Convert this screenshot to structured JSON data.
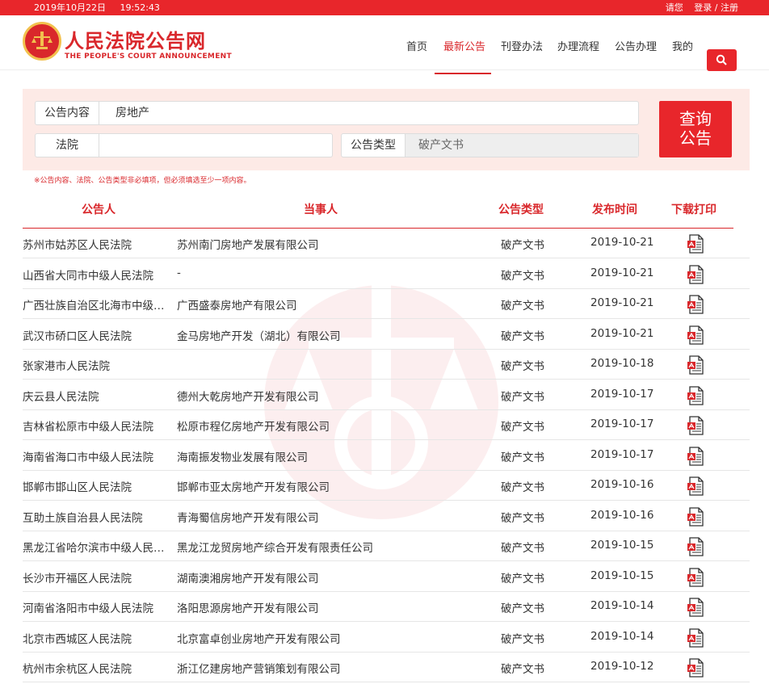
{
  "topbar": {
    "date": "2019年10月22日",
    "time": "19:52:43",
    "greeting": "请您",
    "login": "登录 / 注册"
  },
  "brand": {
    "name": "人民法院公告网",
    "english": "THE PEOPLE'S COURT ANNOUNCEMENT"
  },
  "nav": {
    "items": [
      "首页",
      "最新公告",
      "刊登办法",
      "办理流程",
      "公告办理",
      "我的"
    ],
    "active_index": 1
  },
  "search_form": {
    "content_label": "公告内容",
    "content_value": "房地产",
    "court_label": "法院",
    "court_value": "",
    "type_label": "公告类型",
    "type_value": "破产文书",
    "query_button": [
      "查询",
      "公告"
    ],
    "hint": "※公告内容、法院、公告类型非必填项，但必须填选至少一项内容。"
  },
  "table": {
    "headers": [
      "公告人",
      "当事人",
      "公告类型",
      "发布时间",
      "下载打印"
    ],
    "rows": [
      {
        "court": "苏州市姑苏区人民法院",
        "party": "苏州南门房地产发展有限公司",
        "type": "破产文书",
        "date": "2019-10-21"
      },
      {
        "court": "山西省大同市中级人民法院",
        "party": "-",
        "type": "破产文书",
        "date": "2019-10-21"
      },
      {
        "court": "广西壮族自治区北海市中级人...",
        "party": "广西盛泰房地产有限公司",
        "type": "破产文书",
        "date": "2019-10-21"
      },
      {
        "court": "武汉市硚口区人民法院",
        "party": "金马房地产开发（湖北）有限公司",
        "type": "破产文书",
        "date": "2019-10-21"
      },
      {
        "court": "张家港市人民法院",
        "party": "",
        "type": "破产文书",
        "date": "2019-10-18"
      },
      {
        "court": "庆云县人民法院",
        "party": "德州大乾房地产开发有限公司",
        "type": "破产文书",
        "date": "2019-10-17"
      },
      {
        "court": "吉林省松原市中级人民法院",
        "party": "松原市程亿房地产开发有限公司",
        "type": "破产文书",
        "date": "2019-10-17"
      },
      {
        "court": "海南省海口市中级人民法院",
        "party": "海南振发物业发展有限公司",
        "type": "破产文书",
        "date": "2019-10-17"
      },
      {
        "court": "邯郸市邯山区人民法院",
        "party": "邯郸市亚太房地产开发有限公司",
        "type": "破产文书",
        "date": "2019-10-16"
      },
      {
        "court": "互助土族自治县人民法院",
        "party": "青海蜀信房地产开发有限公司",
        "type": "破产文书",
        "date": "2019-10-16"
      },
      {
        "court": "黑龙江省哈尔滨市中级人民法院",
        "party": "黑龙江龙贸房地产综合开发有限责任公司",
        "type": "破产文书",
        "date": "2019-10-15"
      },
      {
        "court": "长沙市开福区人民法院",
        "party": "湖南澳湘房地产开发有限公司",
        "type": "破产文书",
        "date": "2019-10-15"
      },
      {
        "court": "河南省洛阳市中级人民法院",
        "party": "洛阳思源房地产开发有限公司",
        "type": "破产文书",
        "date": "2019-10-14"
      },
      {
        "court": "北京市西城区人民法院",
        "party": "北京富卓创业房地产开发有限公司",
        "type": "破产文书",
        "date": "2019-10-14"
      },
      {
        "court": "杭州市余杭区人民法院",
        "party": "浙江亿建房地产营销策划有限公司",
        "type": "破产文书",
        "date": "2019-10-12"
      }
    ]
  },
  "icons": {
    "download": "pdf-download-icon",
    "search": "search-icon",
    "emblem": "court-emblem-icon"
  },
  "colors": {
    "brand_red": "#e8262b",
    "panel_bg": "#fdeae6"
  }
}
